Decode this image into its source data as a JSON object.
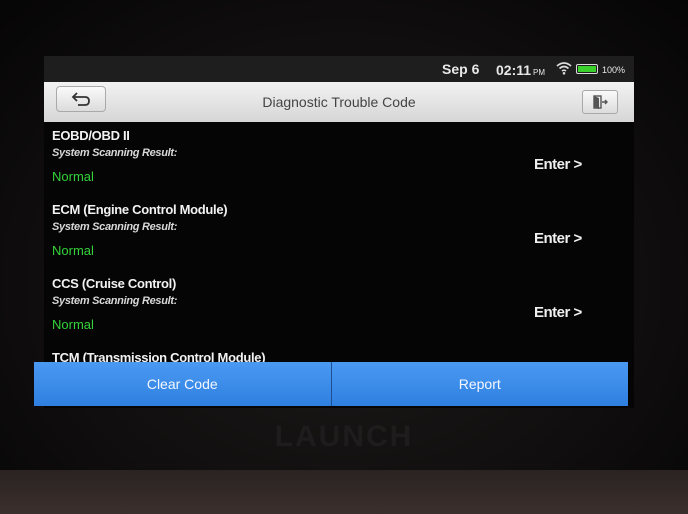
{
  "status_bar": {
    "date": "Sep 6",
    "time": "02:11",
    "ampm": "PM",
    "battery": "100%",
    "icons": [
      "wifi-icon",
      "battery-icon"
    ]
  },
  "header": {
    "title": "Diagnostic Trouble Code",
    "icons": [
      "back-arrow-icon",
      "exit-icon"
    ]
  },
  "systems": [
    {
      "name": "EOBD/OBD II",
      "caption": "System Scanning Result:",
      "status": "Normal",
      "action": "Enter >"
    },
    {
      "name": "ECM (Engine Control Module)",
      "caption": "System Scanning Result:",
      "status": "Normal",
      "action": "Enter >"
    },
    {
      "name": "CCS (Cruise Control)",
      "caption": "System Scanning Result:",
      "status": "Normal",
      "action": "Enter >"
    },
    {
      "name": "TCM (Transmission Control Module)"
    }
  ],
  "buttons": {
    "clear_code": "Clear Code",
    "report": "Report"
  },
  "device": {
    "brand": "LAUNCH"
  },
  "colors": {
    "status_normal": "#35d33a",
    "action_blue": "#3a8ce9",
    "battery_green": "#3ad12c"
  }
}
